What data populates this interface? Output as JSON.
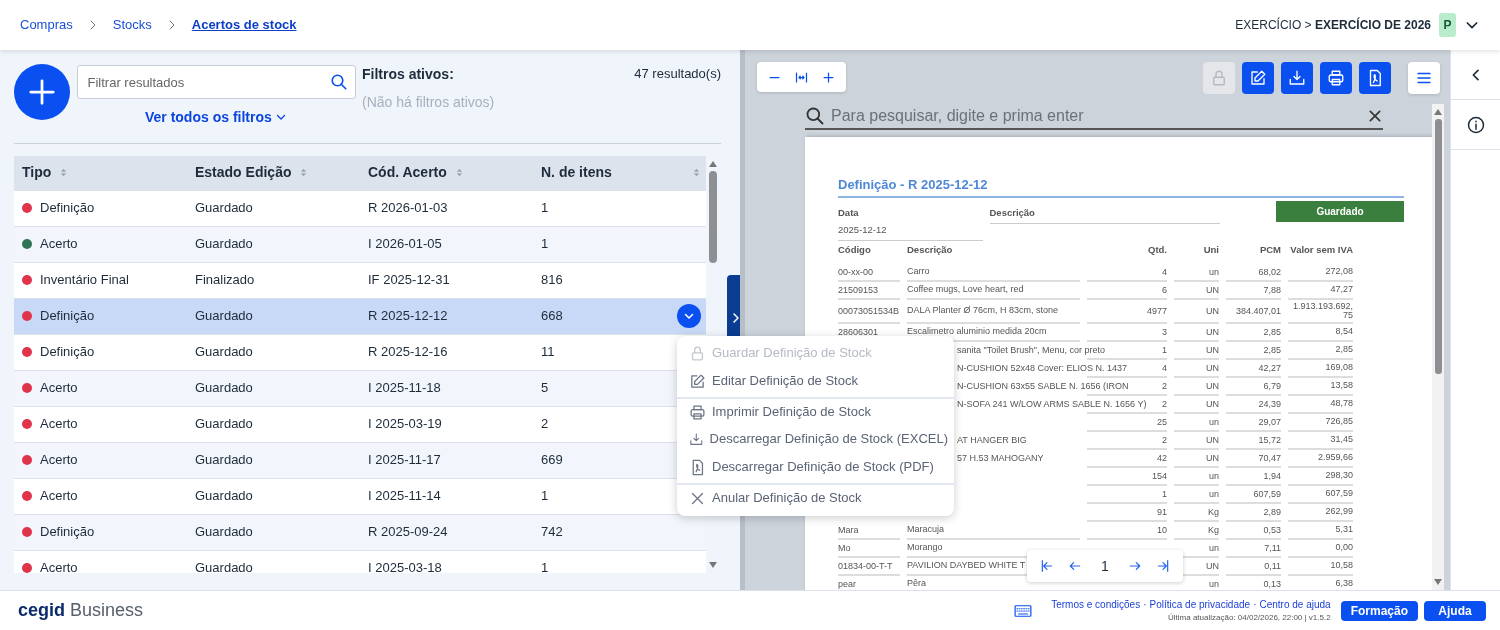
{
  "breadcrumb": [
    {
      "label": "Compras",
      "current": false
    },
    {
      "label": "Stocks",
      "current": false
    },
    {
      "label": "Acertos de stock",
      "current": true
    }
  ],
  "context": {
    "label": "EXERCÍCIO >",
    "value": "EXERCÍCIO DE 2026",
    "avatar": "P"
  },
  "filters": {
    "placeholder": "Filtrar resultados",
    "show_all": "Ver todos os filtros",
    "active_title": "Filtros ativos:",
    "none_text": "(Não há filtros ativos)",
    "count": "47 resultado(s)"
  },
  "table": {
    "columns": [
      "Tipo",
      "Estado Edição",
      "Cód. Acerto",
      "N. de itens"
    ],
    "rows": [
      {
        "tipo": "Definição",
        "color": "#e0344a",
        "estado": "Guardado",
        "codigo": "R 2026-01-03",
        "itens": "1",
        "selected": false
      },
      {
        "tipo": "Acerto",
        "color": "#2e7558",
        "estado": "Guardado",
        "codigo": "I 2026-01-05",
        "itens": "1",
        "selected": false
      },
      {
        "tipo": "Inventário Final",
        "color": "#e0344a",
        "estado": "Finalizado",
        "codigo": "IF 2025-12-31",
        "itens": "816",
        "selected": false
      },
      {
        "tipo": "Definição",
        "color": "#e0344a",
        "estado": "Guardado",
        "codigo": "R 2025-12-12",
        "itens": "668",
        "selected": true
      },
      {
        "tipo": "Definição",
        "color": "#e0344a",
        "estado": "Guardado",
        "codigo": "R 2025-12-16",
        "itens": "11",
        "selected": false
      },
      {
        "tipo": "Acerto",
        "color": "#e0344a",
        "estado": "Guardado",
        "codigo": "I 2025-11-18",
        "itens": "5",
        "selected": false
      },
      {
        "tipo": "Acerto",
        "color": "#e0344a",
        "estado": "Guardado",
        "codigo": "I 2025-03-19",
        "itens": "2",
        "selected": false
      },
      {
        "tipo": "Acerto",
        "color": "#e0344a",
        "estado": "Guardado",
        "codigo": "I 2025-11-17",
        "itens": "669",
        "selected": false
      },
      {
        "tipo": "Acerto",
        "color": "#e0344a",
        "estado": "Guardado",
        "codigo": "I 2025-11-14",
        "itens": "1",
        "selected": false
      },
      {
        "tipo": "Definição",
        "color": "#e0344a",
        "estado": "Guardado",
        "codigo": "R 2025-09-24",
        "itens": "742",
        "selected": false
      },
      {
        "tipo": "Acerto",
        "color": "#e0344a",
        "estado": "Guardado",
        "codigo": "I 2025-03-18",
        "itens": "1",
        "selected": false
      }
    ]
  },
  "menu": {
    "items": [
      {
        "kind": "lock",
        "label": "Guardar Definição de Stock",
        "disabled": true,
        "separator_before": false
      },
      {
        "kind": "edit",
        "label": "Editar Definição de Stock",
        "disabled": false,
        "separator_before": false
      },
      {
        "kind": "print",
        "label": "Imprimir Definição de Stock",
        "disabled": false,
        "separator_before": true
      },
      {
        "kind": "download",
        "label": "Descarregar Definição de Stock (EXCEL)",
        "disabled": false,
        "separator_before": false
      },
      {
        "kind": "pdf",
        "label": "Descarregar Definição de Stock (PDF)",
        "disabled": false,
        "separator_before": false
      },
      {
        "kind": "cancel",
        "label": "Anular Definição de Stock",
        "disabled": false,
        "separator_before": true
      }
    ]
  },
  "viewer": {
    "tools": [
      {
        "kind": "lock",
        "disabled": true
      },
      {
        "kind": "edit",
        "disabled": false
      },
      {
        "kind": "download",
        "disabled": false
      },
      {
        "kind": "print",
        "disabled": false
      },
      {
        "kind": "pdf",
        "disabled": false
      },
      {
        "kind": "menu",
        "disabled": false
      }
    ],
    "search_placeholder": "Para pesquisar, digite e prima enter",
    "document": {
      "title": "Definição - R 2025-12-12",
      "status": "Guardado",
      "fields": [
        {
          "label": "Data",
          "value": "2025-12-12"
        },
        {
          "label": "Descrição"
        }
      ],
      "columns": [
        "Código",
        "Descrição",
        "Qtd.",
        "Uni",
        "PCM",
        "Valor sem IVA"
      ],
      "rows": [
        {
          "kind": "full",
          "code": "00-xx-00",
          "desc": "Carro",
          "qty": "4",
          "unit": "un",
          "pcm": "68,02",
          "value": "272,08"
        },
        {
          "kind": "full",
          "code": "21509153",
          "desc": "Coffee mugs, Love heart, red",
          "qty": "6",
          "unit": "UN",
          "pcm": "7,88",
          "value": "47,27"
        },
        {
          "kind": "full",
          "code": "00073051534B",
          "desc": "DALA Planter Ø 76cm, H 83cm, stone",
          "qty": "4977",
          "unit": "UN",
          "pcm": "384.407,01",
          "value": "1.913.193.692,75"
        },
        {
          "kind": "full",
          "code": "28606301",
          "desc": "Escalimetro aluminio medida 20cm",
          "qty": "3",
          "unit": "UN",
          "pcm": "2,85",
          "value": "8,54"
        },
        {
          "kind": "partial",
          "desc": "sanita \"Toilet Brush\", Menu, cor preto",
          "qty": "1",
          "unit": "UN",
          "pcm": "2,85",
          "value": "2,85"
        },
        {
          "kind": "partial",
          "desc": "N-CUSHION 52x48 Cover: ELIOS N. 1437",
          "qty": "4",
          "unit": "UN",
          "pcm": "42,27",
          "value": "169,08"
        },
        {
          "kind": "partial",
          "desc": "N-CUSHION 63x55 SABLE N. 1656 (IRON",
          "qty": "2",
          "unit": "UN",
          "pcm": "6,79",
          "value": "13,58"
        },
        {
          "kind": "partial",
          "desc": "N-SOFA 241 W/LOW ARMS SABLE N. 1656 Y)",
          "qty": "2",
          "unit": "UN",
          "pcm": "24,39",
          "value": "48,78"
        },
        {
          "kind": "partial",
          "qty": "25",
          "unit": "un",
          "pcm": "29,07",
          "value": "726,85"
        },
        {
          "kind": "partial",
          "desc": "AT HANGER BIG",
          "qty": "2",
          "unit": "UN",
          "pcm": "15,72",
          "value": "31,45"
        },
        {
          "kind": "partial",
          "desc": "57 H.53 MAHOGANY",
          "qty": "42",
          "unit": "UN",
          "pcm": "70,47",
          "value": "2.959,66"
        },
        {
          "kind": "partial",
          "qty": "154",
          "unit": "un",
          "pcm": "1,94",
          "value": "298,30"
        },
        {
          "kind": "partial",
          "qty": "1",
          "unit": "un",
          "pcm": "607,59",
          "value": "607,59"
        },
        {
          "kind": "partial",
          "qty": "91",
          "unit": "Kg",
          "pcm": "2,89",
          "value": "262,99"
        },
        {
          "kind": "full",
          "code": "Mara",
          "desc": "Maracuja",
          "qty": "10",
          "unit": "Kg",
          "pcm": "0,53",
          "value": "5,31"
        },
        {
          "kind": "full",
          "code": "Mo",
          "desc": "Morango",
          "unit": "un",
          "pcm": "7,11",
          "value": "0,00"
        },
        {
          "kind": "full",
          "code": "01834-00-T-T",
          "desc": "PAVILION DAYBED WHITE T",
          "unit": "UN",
          "pcm": "0,11",
          "value": "10,58"
        },
        {
          "kind": "full",
          "code": "pear",
          "desc": "Pêra",
          "unit": "un",
          "pcm": "0,13",
          "value": "6,38"
        }
      ]
    },
    "pager": {
      "page": "1"
    }
  },
  "footer": {
    "brand": "cegid",
    "product": "Business",
    "links": [
      "Termos e condições",
      "Política de privacidade",
      "Centro de ajuda"
    ],
    "link_separator": "·",
    "updated": "Última atualização: 04/02/2026, 22:00 | v1.5.2",
    "buttons": [
      "Formação",
      "Ajuda"
    ]
  }
}
